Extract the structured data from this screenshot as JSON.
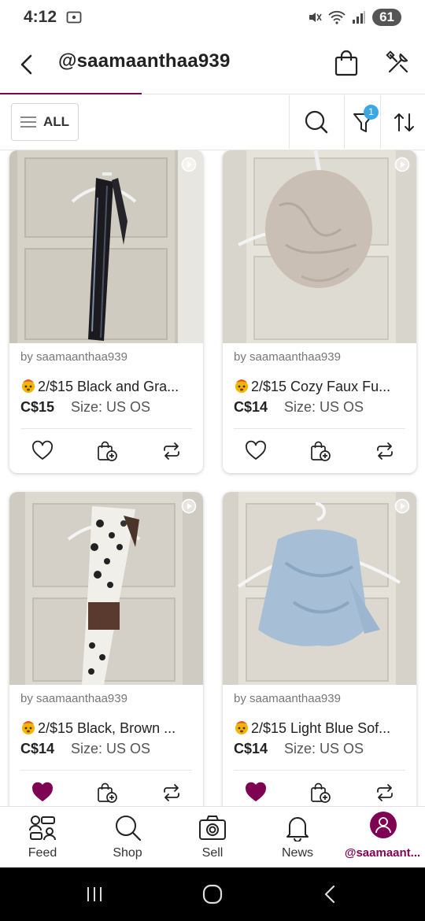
{
  "status_bar": {
    "time": "4:12",
    "battery": "61"
  },
  "header": {
    "title": "@saamaanthaa939"
  },
  "filter_bar": {
    "all_label": "ALL",
    "filter_count": "1"
  },
  "listings": [
    {
      "seller": "by saamaanthaa939",
      "title": "2/$15 Black and Gra...",
      "price": "C$15",
      "size": "Size: US OS",
      "liked": false,
      "image": "black-gray-scarf"
    },
    {
      "seller": "by saamaanthaa939",
      "title": "2/$15 Cozy Faux Fu...",
      "price": "C$14",
      "size": "Size: US OS",
      "liked": false,
      "image": "faux-fur-scarf"
    },
    {
      "seller": "by saamaanthaa939",
      "title": "2/$15 Black, Brown ...",
      "price": "C$14",
      "size": "Size: US OS",
      "liked": true,
      "image": "animal-print-scarf"
    },
    {
      "seller": "by saamaanthaa939",
      "title": "2/$15 Light Blue Sof...",
      "price": "C$14",
      "size": "Size: US OS",
      "liked": true,
      "image": "light-blue-scarf"
    }
  ],
  "bottom_nav": [
    {
      "label": "Feed",
      "icon": "feed-icon"
    },
    {
      "label": "Shop",
      "icon": "search-icon"
    },
    {
      "label": "Sell",
      "icon": "camera-icon"
    },
    {
      "label": "News",
      "icon": "bell-icon"
    },
    {
      "label": "@saamaant...",
      "icon": "profile-avatar",
      "active": true
    }
  ],
  "colors": {
    "brand": "#7f0353",
    "badge": "#3aa8e3",
    "liked": "#7f0353"
  }
}
